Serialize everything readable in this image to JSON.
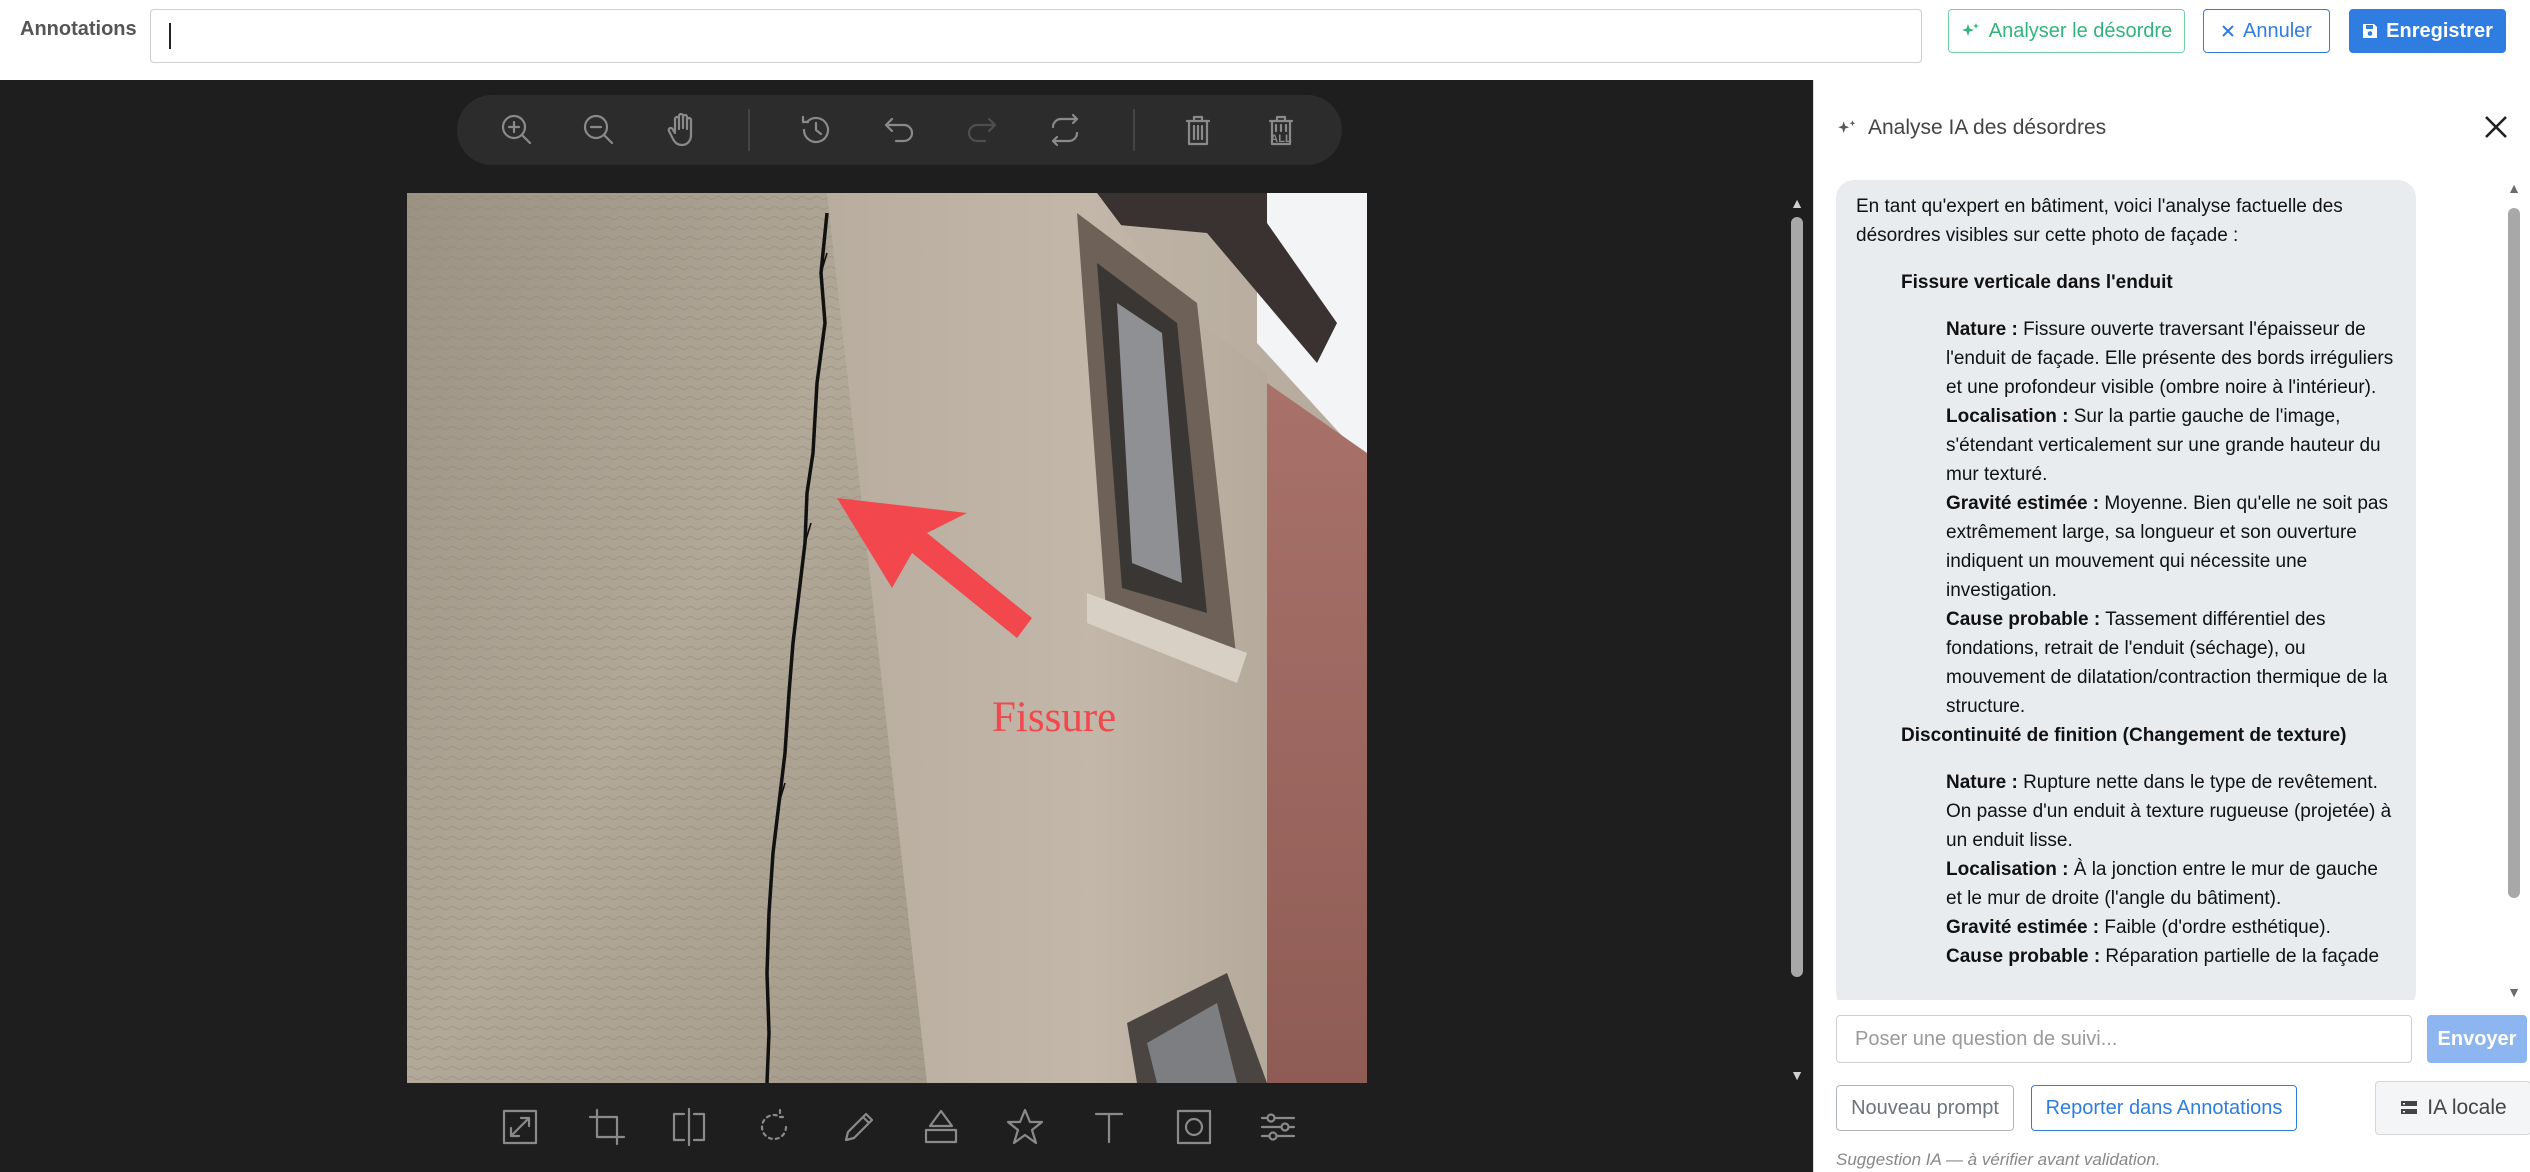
{
  "topbar": {
    "label": "Annotations",
    "annotation_value": "",
    "analyse_label": "Analyser le désordre",
    "cancel_label": "Annuler",
    "save_label": "Enregistrer"
  },
  "editor": {
    "top_tools": [
      "zoom-in",
      "zoom-out",
      "pan",
      "history",
      "undo",
      "redo",
      "reset",
      "delete",
      "delete-all"
    ],
    "delete_all_text": "ALL",
    "bottom_tools": [
      "resize",
      "crop",
      "flip",
      "rotate",
      "draw",
      "shape",
      "icon",
      "text",
      "mask",
      "filter"
    ],
    "annotation_text": "Fissure",
    "annotation_color": "#f2474c"
  },
  "panel": {
    "title": "Analyse IA des désordres",
    "intro": "En tant qu'expert en bâtiment, voici l'analyse factuelle des désordres visibles sur cette photo de façade :",
    "sections": [
      {
        "heading": "Fissure verticale dans l'enduit",
        "items": [
          {
            "key": "Nature :",
            "text": " Fissure ouverte traversant l'épaisseur de l'enduit de façade. Elle présente des bords irréguliers et une profondeur visible (ombre noire à l'intérieur)."
          },
          {
            "key": "Localisation :",
            "text": " Sur la partie gauche de l'image, s'étendant verticalement sur une grande hauteur du mur texturé."
          },
          {
            "key": "Gravité estimée :",
            "text": " Moyenne. Bien qu'elle ne soit pas extrêmement large, sa longueur et son ouverture indiquent un mouvement qui nécessite une investigation."
          },
          {
            "key": "Cause probable :",
            "text": " Tassement différentiel des fondations, retrait de l'enduit (séchage), ou mouvement de dilatation/contraction thermique de la structure."
          }
        ]
      },
      {
        "heading": "Discontinuité de finition (Changement de texture)",
        "items": [
          {
            "key": "Nature :",
            "text": " Rupture nette dans le type de revêtement. On passe d'un enduit à texture rugueuse (projetée) à un enduit lisse."
          },
          {
            "key": "Localisation :",
            "text": " À la jonction entre le mur de gauche et le mur de droite (l'angle du bâtiment)."
          },
          {
            "key": "Gravité estimée :",
            "text": " Faible (d'ordre esthétique)."
          },
          {
            "key": "Cause probable :",
            "text": " Réparation partielle de la façade"
          }
        ]
      }
    ],
    "followup_placeholder": "Poser une question de suivi...",
    "send_label": "Envoyer",
    "new_prompt_label": "Nouveau prompt",
    "report_label": "Reporter dans Annotations",
    "local_ai_label": "IA locale",
    "hint": "Suggestion IA — à vérifier avant validation."
  }
}
